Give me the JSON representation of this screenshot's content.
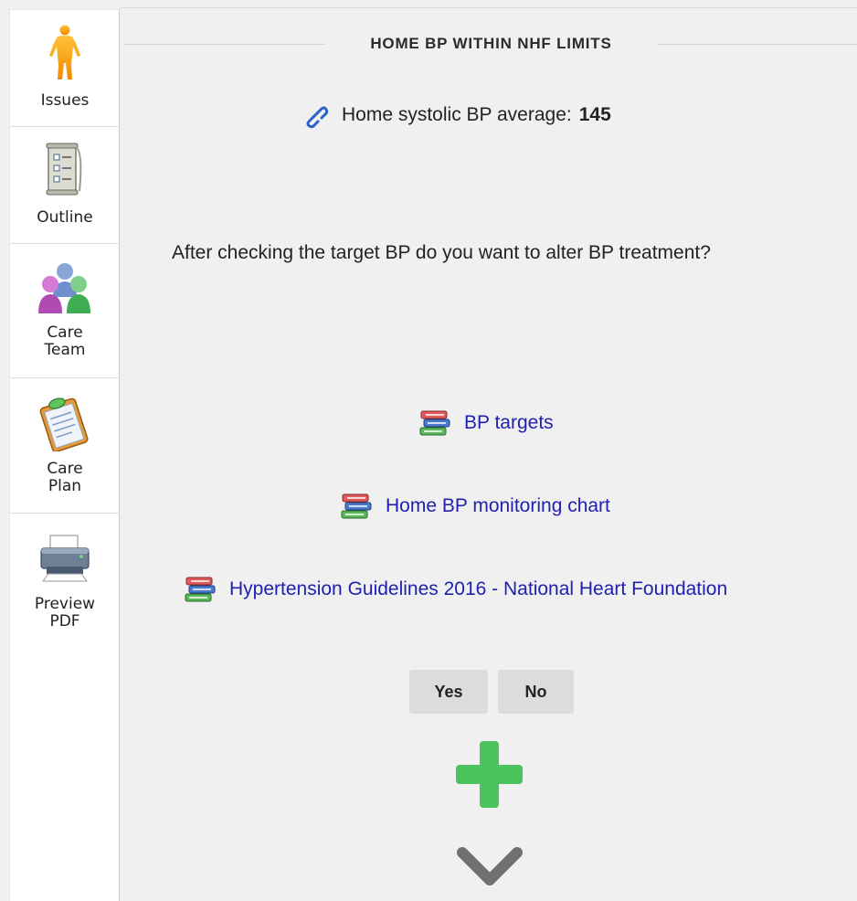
{
  "sidebar": {
    "items": [
      {
        "label": "Issues",
        "icon": "body-figure-icon"
      },
      {
        "label": "Outline",
        "icon": "scroll-list-icon"
      },
      {
        "label_line1": "Care",
        "label_line2": "Team",
        "icon": "care-team-people-icon"
      },
      {
        "label_line1": "Care",
        "label_line2": "Plan",
        "icon": "clipboard-icon"
      },
      {
        "label_line1": "Preview",
        "label_line2": "PDF",
        "icon": "printer-icon"
      }
    ]
  },
  "main": {
    "section_title": "HOME BP WITHIN NHF LIMITS",
    "average_label": "Home systolic BP average:",
    "average_value": "145",
    "question": "After checking the target BP do you want to alter BP treatment?",
    "links": [
      {
        "label": "BP targets",
        "icon": "books-icon"
      },
      {
        "label": "Home BP monitoring chart",
        "icon": "books-icon"
      },
      {
        "label": "Hypertension Guidelines 2016 - National Heart Foundation",
        "icon": "books-icon"
      }
    ],
    "yes_label": "Yes",
    "no_label": "No",
    "add_icon": "plus-icon",
    "expand_icon": "chevron-down-icon"
  },
  "colors": {
    "link": "#1f1fb0",
    "plus_green": "#4cc45e",
    "chevron_gray": "#707070",
    "background": "#f0f0f0",
    "button_bg": "#dcdcdc"
  }
}
